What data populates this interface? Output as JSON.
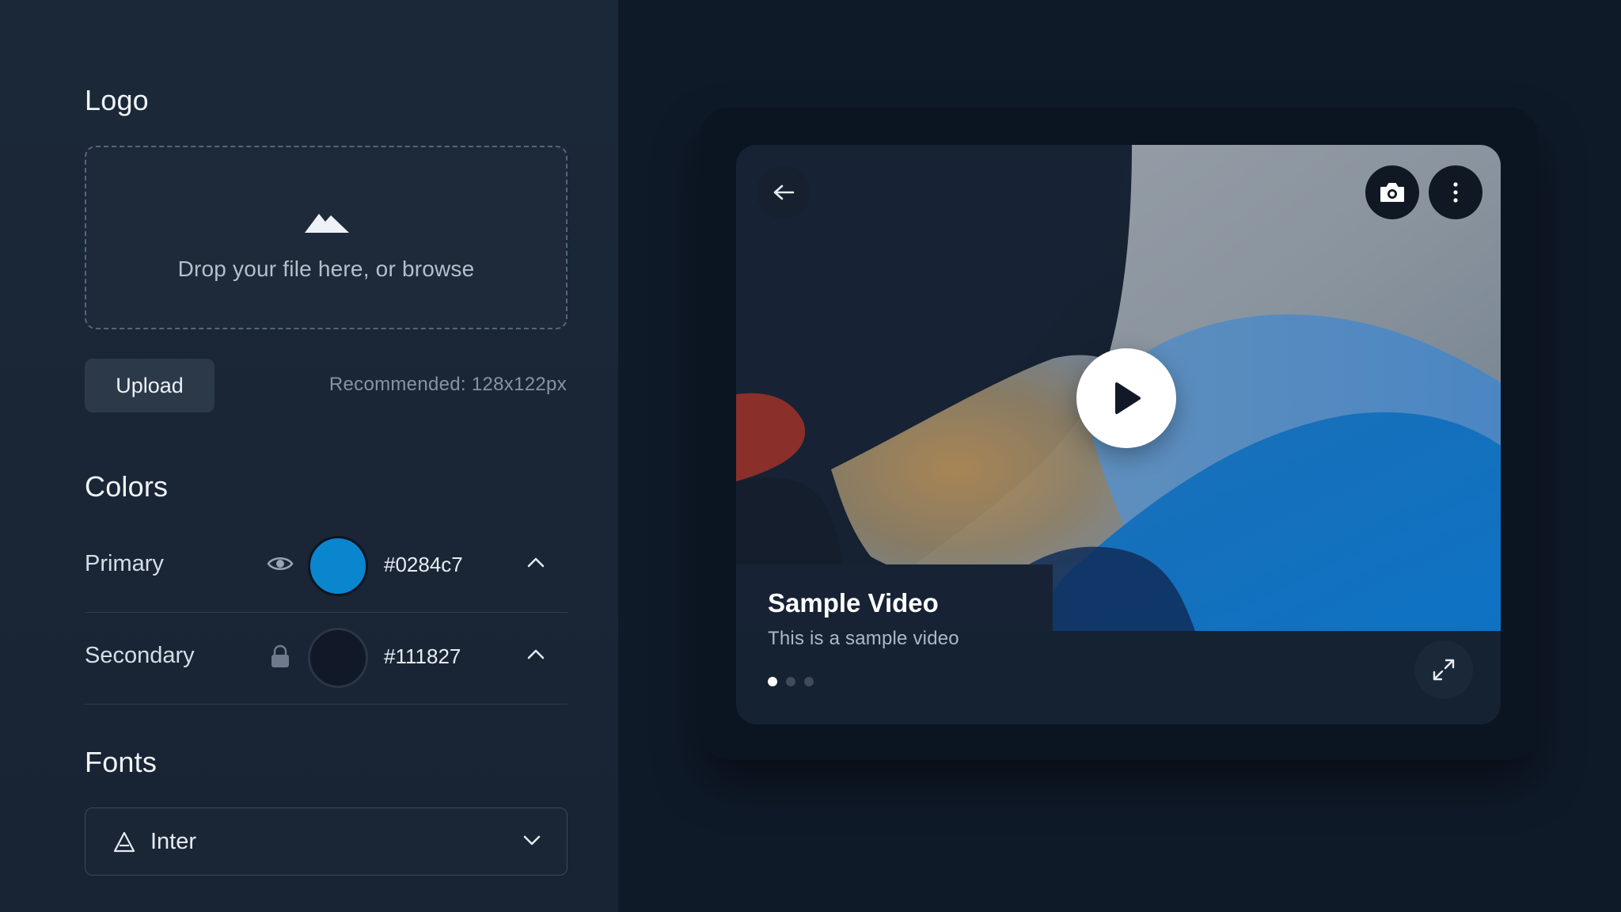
{
  "logo": {
    "title": "Logo",
    "dropzone_text": "Drop your file here, or browse",
    "dropzone_icon": "mountain-icon",
    "upload_label": "Upload",
    "recommended": "Recommended: 128x122px"
  },
  "colors": {
    "title": "Colors",
    "items": [
      {
        "label": "Primary",
        "hex": "#0284c7",
        "icon": "eye-icon",
        "swatch": "#0a86cf"
      },
      {
        "label": "Secondary",
        "hex": "#111827",
        "icon": "lock-icon",
        "swatch": "#111827"
      }
    ]
  },
  "fonts": {
    "title": "Fonts",
    "selected": "Inter",
    "icon": "font-icon"
  },
  "preview": {
    "video_title": "Sample Video",
    "video_subtitle": "This is a sample video",
    "slides_total": 3,
    "slide_active": 1,
    "icons": {
      "back": "arrow-left-icon",
      "camera": "camera-icon",
      "menu": "more-vertical-icon",
      "play": "play-icon",
      "fullscreen": "expand-icon"
    }
  }
}
